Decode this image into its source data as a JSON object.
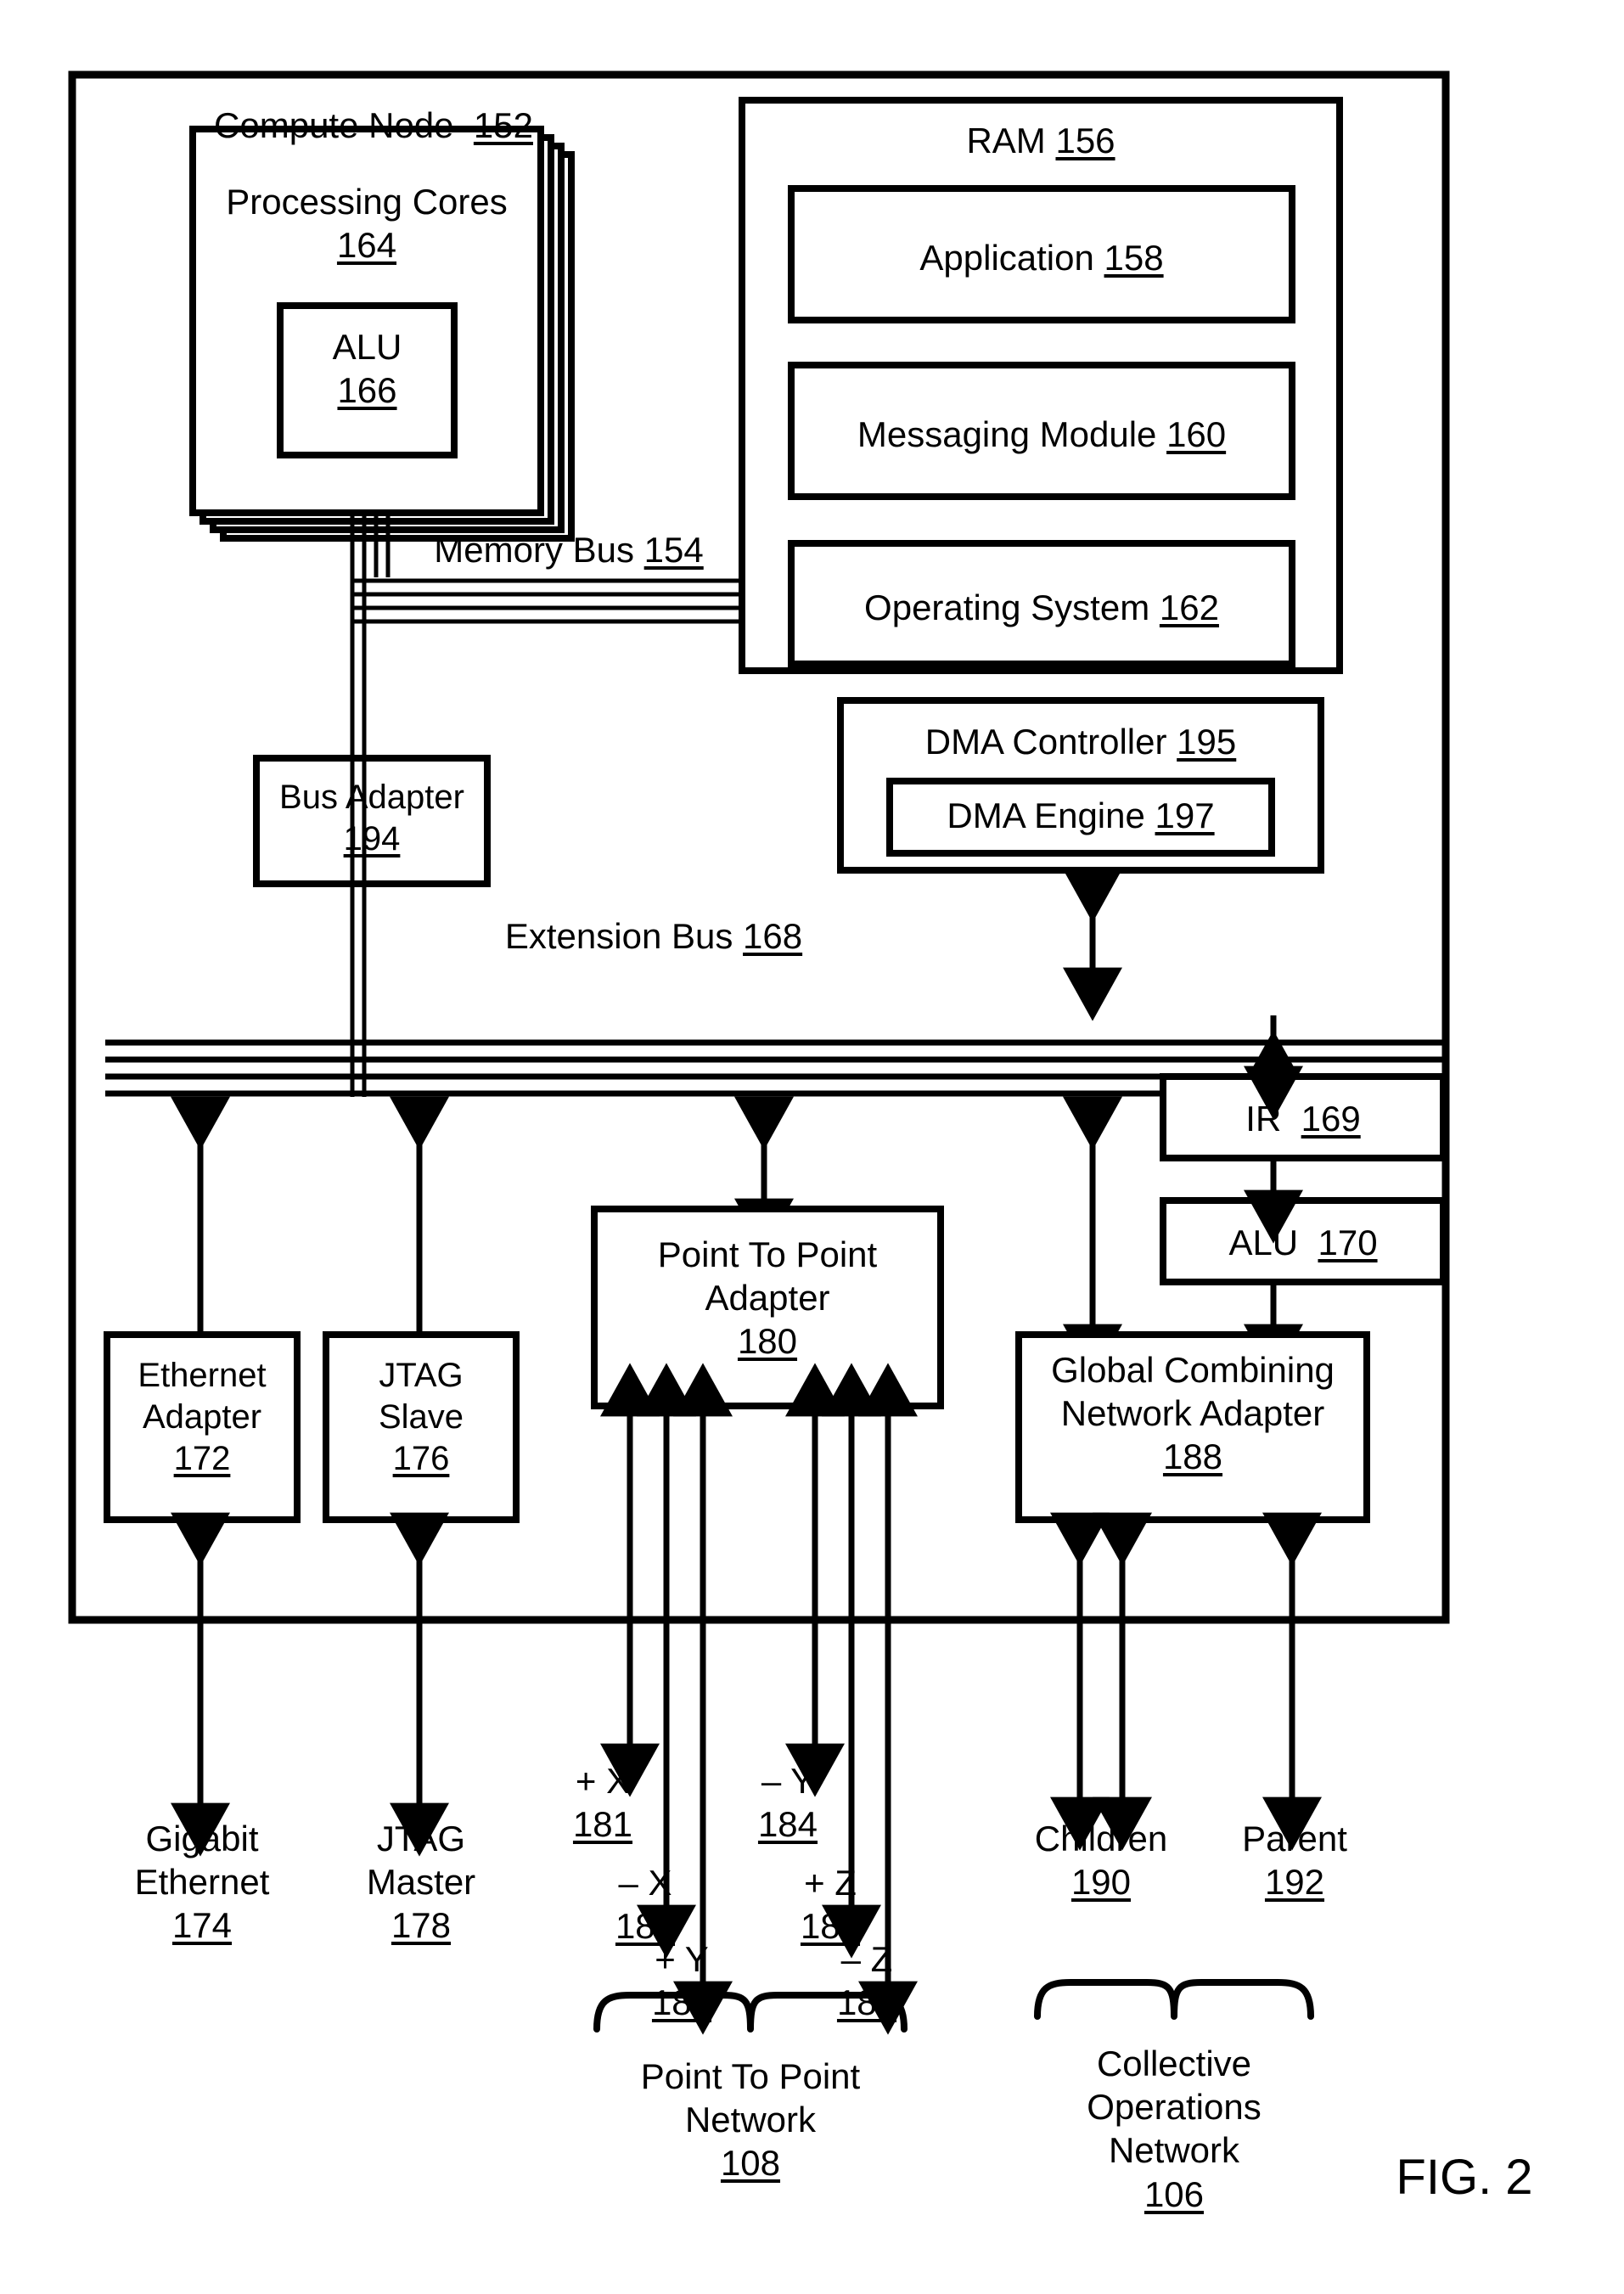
{
  "figure": {
    "caption": "FIG. 2",
    "outer_block": {
      "title": "Compute Node",
      "ref": "152"
    }
  },
  "blocks": {
    "processing_cores": {
      "line1": "Processing Cores",
      "ref": "164",
      "stack_count": 4
    },
    "alu_core": {
      "line1": "ALU",
      "ref": "166"
    },
    "ram": {
      "line1": "RAM",
      "ref": "156"
    },
    "application": {
      "line1": "Application",
      "ref": "158"
    },
    "messaging_module": {
      "line1": "Messaging Module",
      "ref": "160"
    },
    "operating_system": {
      "line1": "Operating System",
      "ref": "162"
    },
    "memory_bus": {
      "line1": "Memory Bus",
      "ref": "154"
    },
    "bus_adapter": {
      "line1": "Bus Adapter",
      "ref": "194"
    },
    "extension_bus": {
      "line1": "Extension Bus",
      "ref": "168"
    },
    "dma_controller": {
      "line1": "DMA Controller",
      "ref": "195"
    },
    "dma_engine": {
      "line1": "DMA Engine",
      "ref": "197"
    },
    "ir": {
      "line1": "IR",
      "ref": "169"
    },
    "alu_network": {
      "line1": "ALU",
      "ref": "170"
    },
    "global_combining_network_adapter": {
      "line1": "Global Combining",
      "line2": "Network Adapter",
      "ref": "188"
    },
    "point_to_point_adapter": {
      "line1": "Point To Point",
      "line2": "Adapter",
      "ref": "180"
    },
    "ethernet_adapter": {
      "line1": "Ethernet",
      "line2": "Adapter",
      "ref": "172"
    },
    "jtag_slave": {
      "line1": "JTAG",
      "line2": "Slave",
      "ref": "176"
    }
  },
  "endpoints": {
    "gigabit_ethernet": {
      "line1": "Gigabit",
      "line2": "Ethernet",
      "ref": "174"
    },
    "jtag_master": {
      "line1": "JTAG",
      "line2": "Master",
      "ref": "178"
    },
    "children": {
      "line1": "Children",
      "ref": "190"
    },
    "parent": {
      "line1": "Parent",
      "ref": "192"
    }
  },
  "torus_links": [
    {
      "axis": "+ X",
      "ref": "181"
    },
    {
      "axis": "– X",
      "ref": "182"
    },
    {
      "axis": "+ Y",
      "ref": "183"
    },
    {
      "axis": "– Y",
      "ref": "184"
    },
    {
      "axis": "+ Z",
      "ref": "185"
    },
    {
      "axis": "– Z",
      "ref": "186"
    }
  ],
  "networks": {
    "point_to_point_network": {
      "line1": "Point To Point",
      "line2": "Network",
      "ref": "108"
    },
    "collective_operations_network": {
      "line1": "Collective",
      "line2": "Operations",
      "line3": "Network",
      "ref": "106"
    }
  },
  "colors": {
    "stroke": "#000000",
    "background": "#ffffff"
  }
}
